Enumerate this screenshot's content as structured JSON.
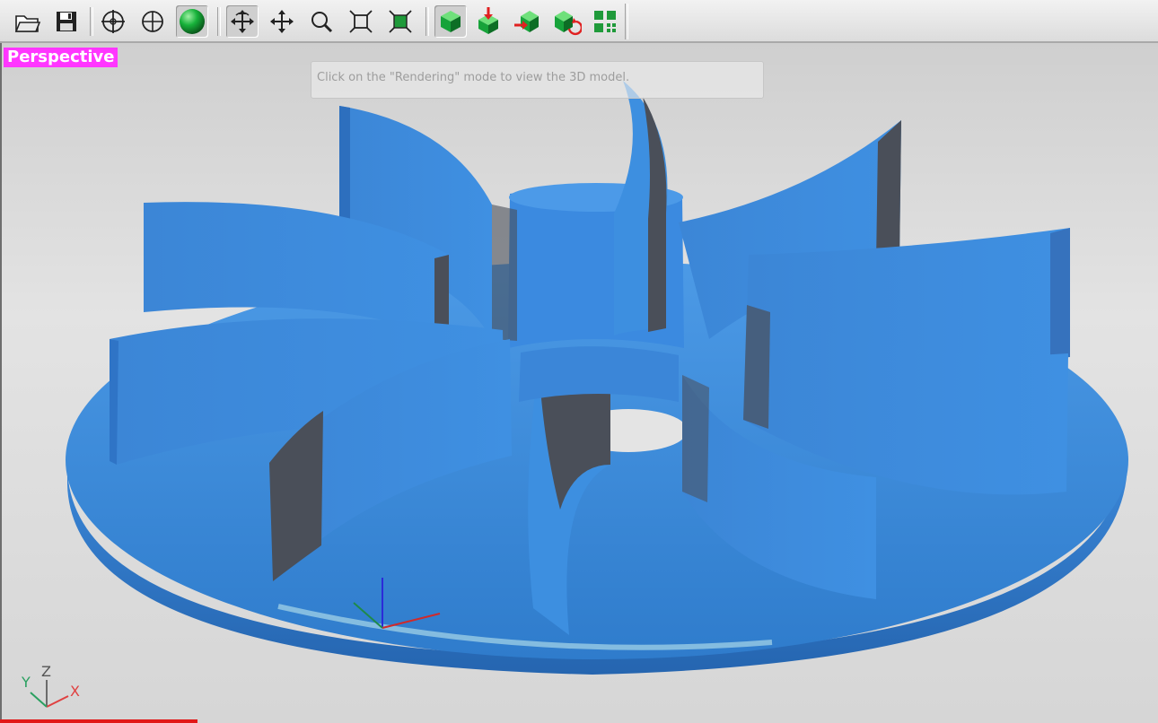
{
  "toolbar": {
    "buttons": [
      {
        "name": "open-file",
        "icon": "folder-open-icon"
      },
      {
        "name": "save-file",
        "icon": "floppy-disk-icon"
      },
      {
        "name": "view-center",
        "icon": "crosshair-circle-icon"
      },
      {
        "name": "view-target",
        "icon": "target-circle-icon"
      },
      {
        "name": "render-shaded",
        "icon": "green-sphere-icon"
      },
      {
        "name": "rotate",
        "icon": "rotate-arrows-icon",
        "active": true
      },
      {
        "name": "pan",
        "icon": "move-arrows-icon"
      },
      {
        "name": "zoom",
        "icon": "magnifier-icon"
      },
      {
        "name": "zoom-fit",
        "icon": "zoom-extents-icon"
      },
      {
        "name": "zoom-selected",
        "icon": "zoom-box-icon"
      },
      {
        "name": "green-cube",
        "icon": "green-cube-icon"
      },
      {
        "name": "cube-red-arrow-down",
        "icon": "cube-arrow-down-icon"
      },
      {
        "name": "cube-red-arrow-left",
        "icon": "cube-arrow-in-icon"
      },
      {
        "name": "cube-rotate",
        "icon": "cube-rotate-icon"
      },
      {
        "name": "grid-view",
        "icon": "grid-squares-icon"
      }
    ]
  },
  "viewport": {
    "label": "Perspective",
    "label_color": "#ff36ff",
    "hint": "Click on the \"Rendering\" mode to view the 3D model.",
    "model_color": "#3d8fe0",
    "model_shadow_color": "#4a4f59",
    "axis_triad": {
      "z": "Z",
      "y": "Y",
      "x": "X"
    }
  }
}
